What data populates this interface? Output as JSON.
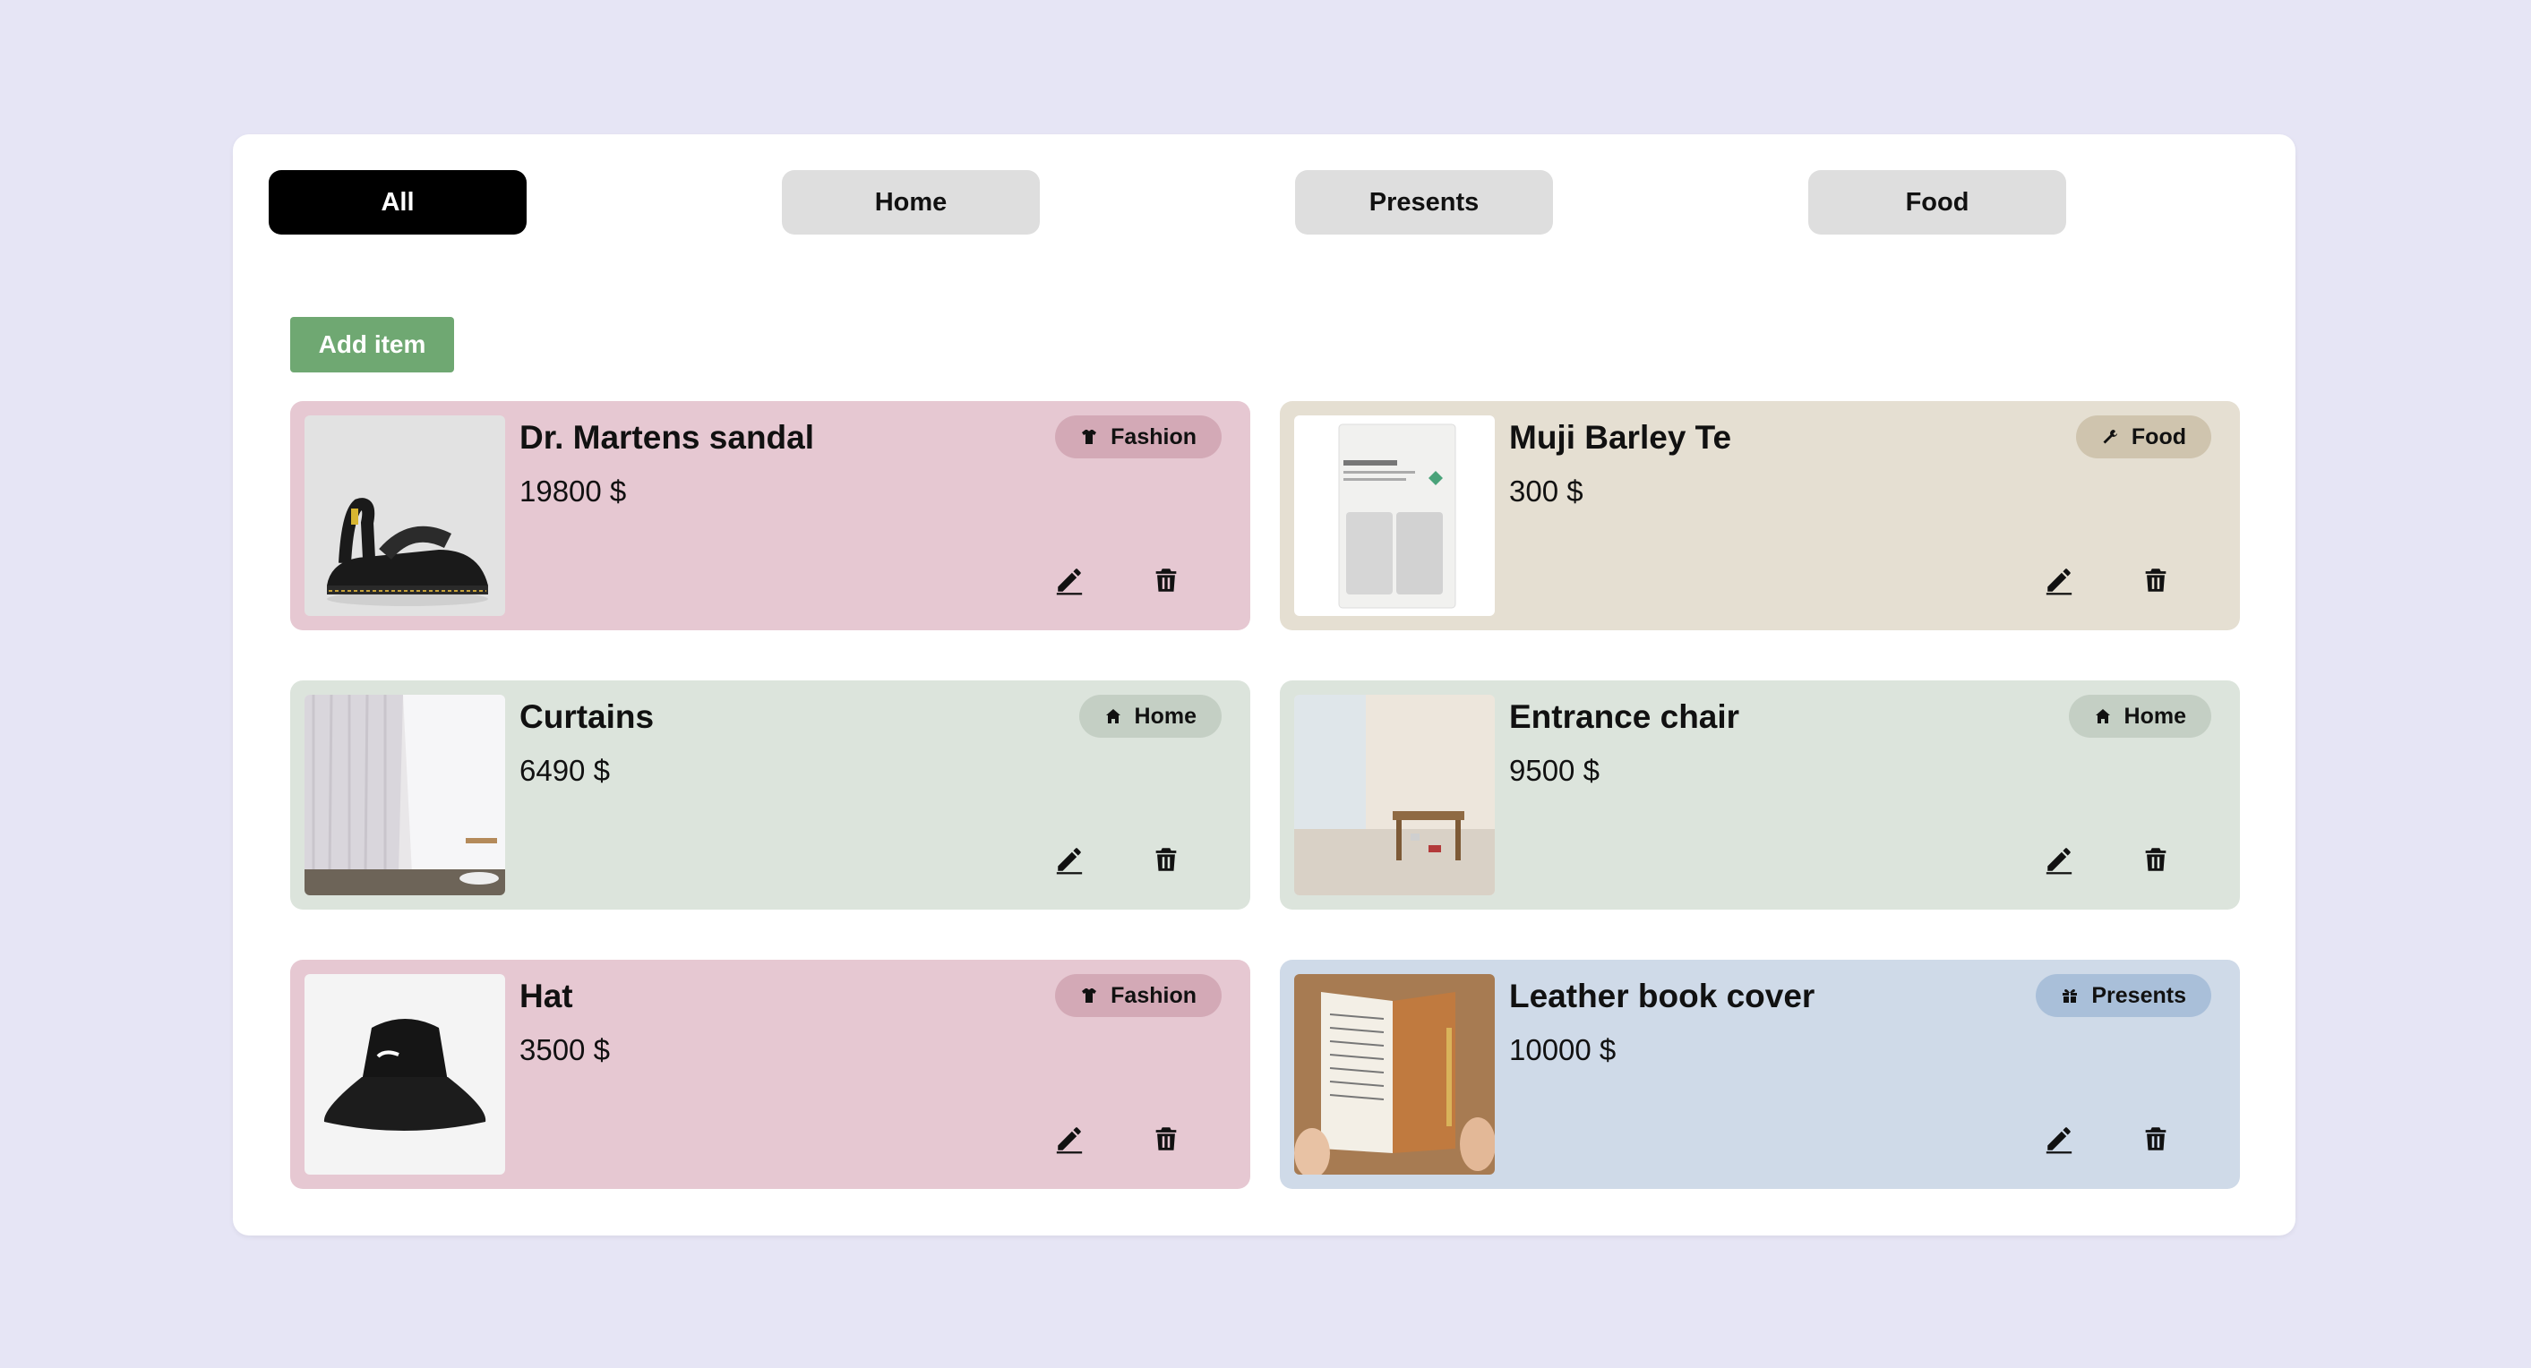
{
  "filters": {
    "tabs": [
      {
        "label": "All",
        "active": true
      },
      {
        "label": "Home",
        "active": false
      },
      {
        "label": "Presents",
        "active": false
      },
      {
        "label": "Food",
        "active": false
      }
    ]
  },
  "toolbar": {
    "add_label": "Add item"
  },
  "colors": {
    "fashion_card": "#e6c8d2",
    "fashion_tag": "#d3a9b6",
    "food_card": "#e5dfd2",
    "food_tag": "#cfc4ae",
    "home_card": "#dce4dc",
    "home_tag": "#c4cfc4",
    "presents_card": "#cfdae8",
    "presents_tag": "#a9bfd9"
  },
  "items": [
    {
      "name": "Dr. Martens sandal",
      "price": "19800 $",
      "category": "Fashion",
      "icon": "shirt-icon",
      "image": "sandal-image"
    },
    {
      "name": "Muji Barley Te",
      "price": "300 $",
      "category": "Food",
      "icon": "tool-icon",
      "image": "tea-package-image"
    },
    {
      "name": "Curtains",
      "price": "6490 $",
      "category": "Home",
      "icon": "house-icon",
      "image": "curtains-image"
    },
    {
      "name": "Entrance chair",
      "price": "9500 $",
      "category": "Home",
      "icon": "house-icon",
      "image": "entrance-chair-image"
    },
    {
      "name": "Hat",
      "price": "3500 $",
      "category": "Fashion",
      "icon": "shirt-icon",
      "image": "bucket-hat-image"
    },
    {
      "name": "Leather book cover",
      "price": "10000 $",
      "category": "Presents",
      "icon": "gift-icon",
      "image": "book-cover-image"
    }
  ]
}
